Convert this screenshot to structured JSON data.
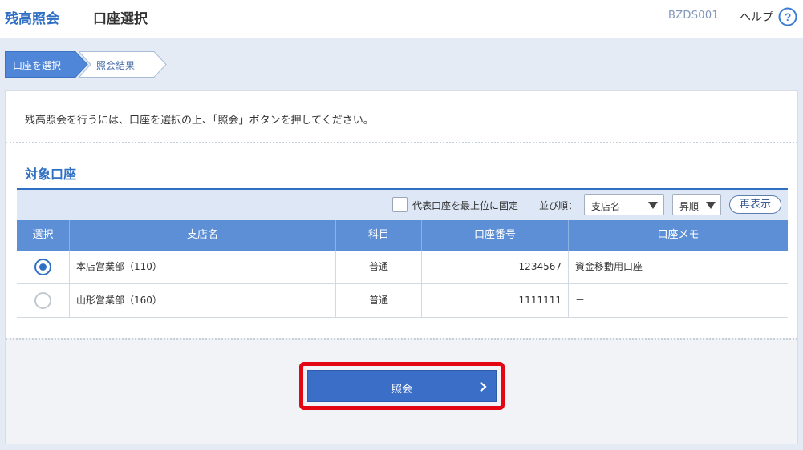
{
  "header": {
    "app_title": "残高照会",
    "page_title": "口座選択",
    "screen_id": "BZDS001",
    "help_label": "ヘルプ"
  },
  "steps": [
    {
      "label": "口座を選択",
      "active": true
    },
    {
      "label": "照会結果",
      "active": false
    }
  ],
  "instruction": "残高照会を行うには、口座を選択の上、「照会」ボタンを押してください。",
  "section_title": "対象口座",
  "toolbar": {
    "checkbox_label": "代表口座を最上位に固定",
    "checkbox_checked": false,
    "sort_label": "並び順：",
    "sort_field": "支店名",
    "sort_order": "昇順",
    "redisplay_label": "再表示"
  },
  "table": {
    "columns": [
      "選択",
      "支店名",
      "科目",
      "口座番号",
      "口座メモ"
    ],
    "rows": [
      {
        "selected": true,
        "branch": "本店営業部（110）",
        "subject": "普通",
        "account_number": "1234567",
        "memo": "資金移動用口座"
      },
      {
        "selected": false,
        "branch": "山形営業部（160）",
        "subject": "普通",
        "account_number": "1111111",
        "memo": "－"
      }
    ]
  },
  "submit_label": "照会",
  "colors": {
    "accent": "#2f6fc4",
    "table_header": "#5d8fd7",
    "highlight": "#e30613",
    "background": "#e4ebf5"
  }
}
